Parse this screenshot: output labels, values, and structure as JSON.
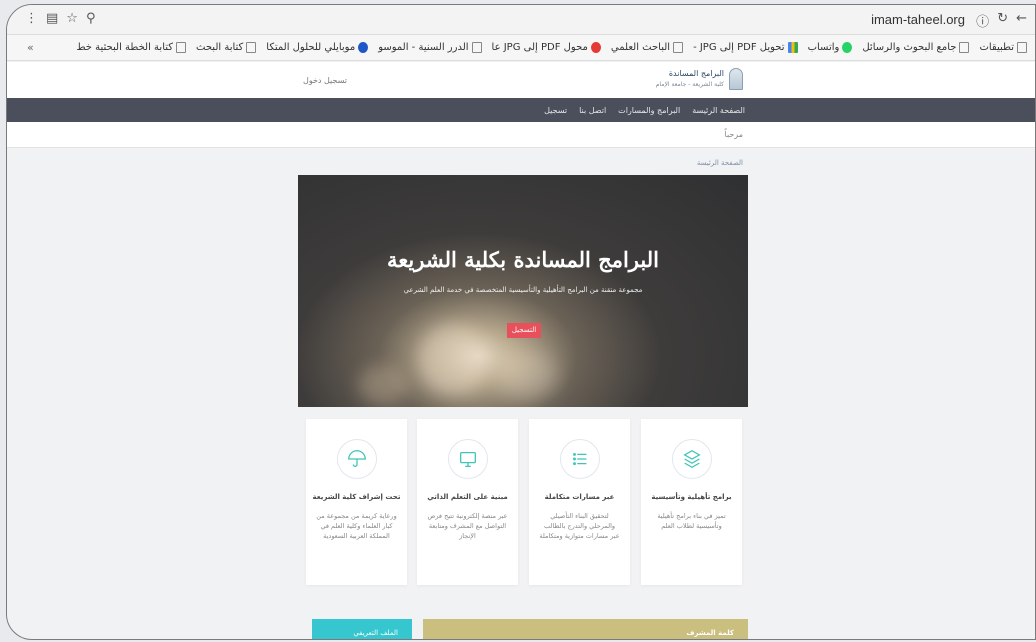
{
  "browser": {
    "url": "imam-taheel.org",
    "bookmarks": [
      {
        "label": "تطبيقات",
        "icon": "apps-grid-icon"
      },
      {
        "label": "جامع البحوث والرسائل",
        "icon": "page-icon"
      },
      {
        "label": "واتساب",
        "icon": "whatsapp-icon"
      },
      {
        "label": "تحويل PDF إلى JPG -",
        "icon": "multicolor-icon"
      },
      {
        "label": "الباحث العلمي",
        "icon": "page-icon"
      },
      {
        "label": "محول PDF إلى JPG عا",
        "icon": "red-circle-icon"
      },
      {
        "label": "الدرر السنية - الموسو",
        "icon": "page-icon"
      },
      {
        "label": "موبايلي للحلول المتكا",
        "icon": "blue-circle-icon"
      },
      {
        "label": "كتابة البحث",
        "icon": "page-icon"
      },
      {
        "label": "كتابة الخطة البحثية خط",
        "icon": "page-icon"
      }
    ],
    "overflow": "«"
  },
  "site": {
    "logo_title": "البرامج المساندة",
    "logo_sub": "كلية الشريعة - جامعة الإمام",
    "login": "تسجيل دخول",
    "nav": [
      "الصفحة الرئيسة",
      "البرامج والمسارات",
      "اتصل بنا",
      "تسجيل"
    ],
    "welcome": "مرحباً",
    "breadcrumb": "الصفحة الرئيسة"
  },
  "hero": {
    "title": "البرامج المساندة بكلية الشريعة",
    "subtitle": "مجموعة متقنة من البرامج التأهيلية والتأسيسية المتخصصة في خدمة العلم الشرعي",
    "button": "التسجيل"
  },
  "cards": [
    {
      "title": "برامج تأهيلية وتأسيسية",
      "desc": "تميز في بناء برامج تأهيلية وتأسيسية لطلاب العلم",
      "icon": "layers-icon"
    },
    {
      "title": "عبر مسارات متكاملة",
      "desc": "لتحقيق البناء التأصيلي والمرحلي والتدرج بالطالب عبر مسارات متوازية ومتكاملة",
      "icon": "list-icon"
    },
    {
      "title": "مبنية على التعلم الذاتي",
      "desc": "عبر منصة إلكترونية تتيح فرص التواصل مع المشرف ومتابعة الإنجاز",
      "icon": "monitor-icon"
    },
    {
      "title": "تحت إشراف كلية الشريعة",
      "desc": "ورعاية كريمة من مجموعة من كبار العلماء وكلية العلم في المملكة العربية السعودية",
      "icon": "umbrella-icon"
    }
  ],
  "bottom": {
    "gold": "كلمة المشرف",
    "cyan": "الملف التعريفي"
  },
  "colors": {
    "navbar": "#4a4f5b",
    "hero_button": "#e8505b",
    "icon_accent": "#3ec5b5",
    "gold": "#cbbf7f",
    "cyan": "#35c6cf"
  }
}
